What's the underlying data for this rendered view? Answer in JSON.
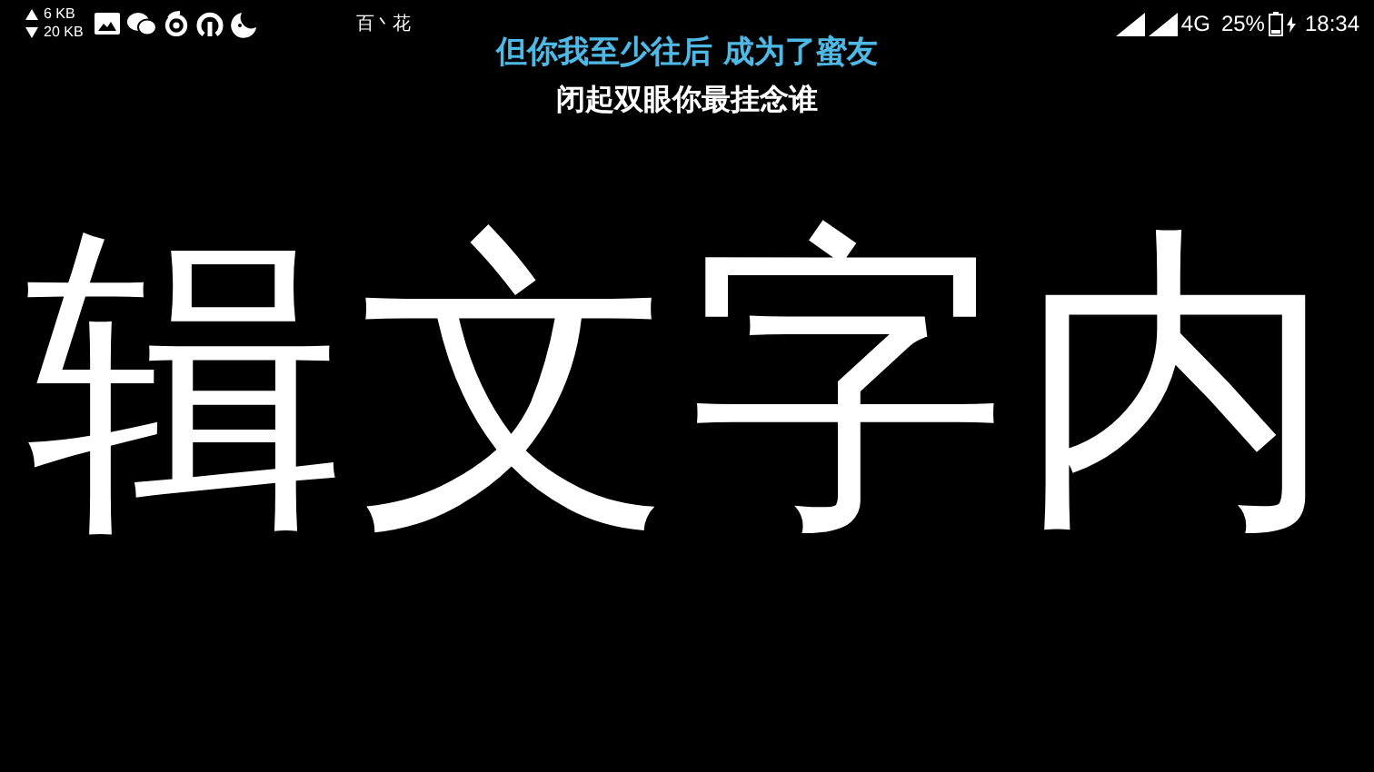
{
  "status_bar": {
    "upload_speed": "6 KB",
    "download_speed": "20 KB",
    "carrier_name": "百丶花",
    "network": "4G",
    "battery": "25%",
    "time": "18:34"
  },
  "lyrics": [
    {
      "text": "但你我至少往后 成为了蜜友",
      "selected": true
    },
    {
      "text": "闭起双眼你最挂念谁",
      "selected": false
    }
  ],
  "marquee": {
    "text": "辑文字内"
  }
}
